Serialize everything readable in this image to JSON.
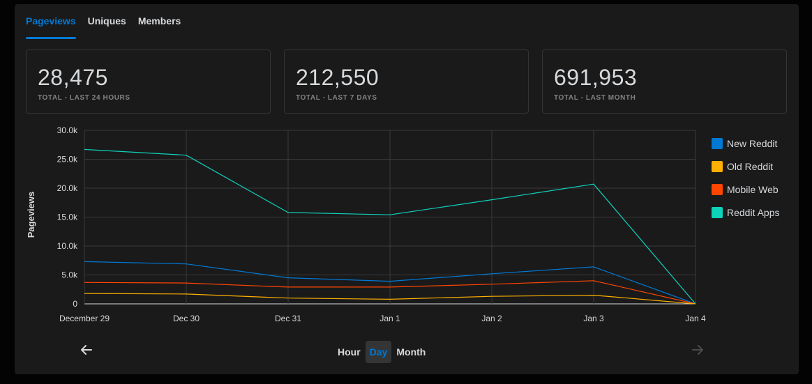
{
  "tabs": [
    {
      "label": "Pageviews",
      "active": true
    },
    {
      "label": "Uniques",
      "active": false
    },
    {
      "label": "Members",
      "active": false
    }
  ],
  "stats": [
    {
      "value": "28,475",
      "label": "TOTAL - LAST 24 HOURS"
    },
    {
      "value": "212,550",
      "label": "TOTAL - LAST 7 DAYS"
    },
    {
      "value": "691,953",
      "label": "TOTAL - LAST MONTH"
    }
  ],
  "chart_data": {
    "type": "line",
    "title": "",
    "xlabel": "",
    "ylabel": "Pageviews",
    "categories": [
      "December 29",
      "Dec 30",
      "Dec 31",
      "Jan 1",
      "Jan 2",
      "Jan 3",
      "Jan 4"
    ],
    "yticks": [
      "0",
      "5.0k",
      "10.0k",
      "15.0k",
      "20.0k",
      "25.0k",
      "30.0k"
    ],
    "ylim": [
      0,
      30000
    ],
    "grid": true,
    "legend_position": "right",
    "series": [
      {
        "name": "New Reddit",
        "color": "#0079d3",
        "values": [
          7300,
          6900,
          4500,
          3900,
          5200,
          6400,
          0
        ]
      },
      {
        "name": "Old Reddit",
        "color": "#ffb000",
        "values": [
          1800,
          1700,
          1000,
          800,
          1300,
          1500,
          0
        ]
      },
      {
        "name": "Mobile Web",
        "color": "#ff4500",
        "values": [
          3700,
          3600,
          2900,
          2900,
          3400,
          4000,
          0
        ]
      },
      {
        "name": "Reddit Apps",
        "color": "#0dd3bb",
        "values": [
          26700,
          25700,
          15800,
          15400,
          18000,
          20700,
          0
        ]
      }
    ]
  },
  "granularity": {
    "options": [
      "Hour",
      "Day",
      "Month"
    ],
    "selected": "Day"
  },
  "nav": {
    "prev_icon": "arrow-left-icon",
    "next_icon": "arrow-right-icon"
  },
  "colors": {
    "accent": "#0079d3",
    "panel": "#1a1a1b",
    "border": "#343536",
    "text": "#d7dadc"
  }
}
